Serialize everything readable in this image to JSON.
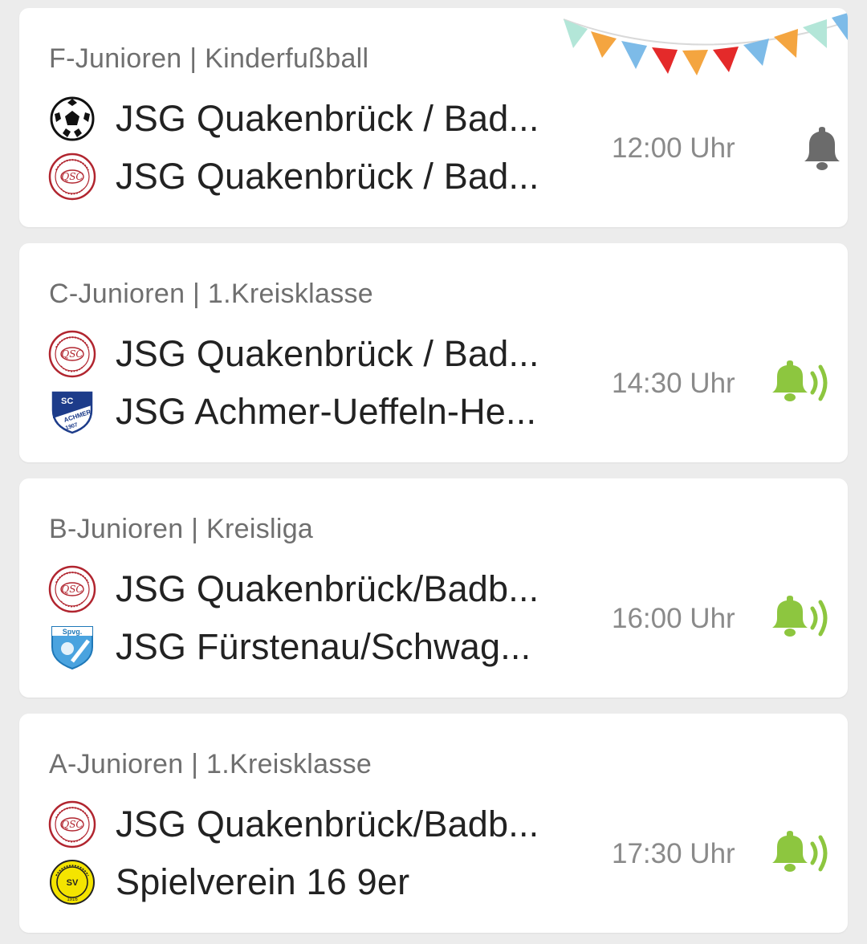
{
  "matches": [
    {
      "league": "F-Junioren | Kinderfußball",
      "home": {
        "name": "JSG Quakenbrück / Bad...",
        "logo": "soccer-ball-icon"
      },
      "away": {
        "name": "JSG Quakenbrück / Bad...",
        "logo": "qsc-crest"
      },
      "time": "12:00 Uhr",
      "notification": "bell-off-icon",
      "decoration": "bunting-garland"
    },
    {
      "league": "C-Junioren | 1.Kreisklasse",
      "home": {
        "name": "JSG Quakenbrück / Bad...",
        "logo": "qsc-crest"
      },
      "away": {
        "name": "JSG Achmer-Ueffeln-He...",
        "logo": "sc-achmer-crest"
      },
      "time": "14:30 Uhr",
      "notification": "bell-ringing-icon"
    },
    {
      "league": "B-Junioren | Kreisliga",
      "home": {
        "name": "JSG Quakenbrück/Badb...",
        "logo": "qsc-crest"
      },
      "away": {
        "name": "JSG Fürstenau/Schwag...",
        "logo": "spvg-fuerstenau-crest"
      },
      "time": "16:00 Uhr",
      "notification": "bell-ringing-icon"
    },
    {
      "league": "A-Junioren | 1.Kreisklasse",
      "home": {
        "name": "JSG Quakenbrück/Badb...",
        "logo": "qsc-crest"
      },
      "away": {
        "name": "Spielverein 16 9er",
        "logo": "spielverein-16-crest"
      },
      "time": "17:30 Uhr",
      "notification": "bell-ringing-icon"
    }
  ],
  "colors": {
    "background": "#ececec",
    "card": "#ffffff",
    "bell_active": "#8dc63f",
    "bell_inactive": "#6b6b6b",
    "qsc_red": "#b1252f"
  }
}
